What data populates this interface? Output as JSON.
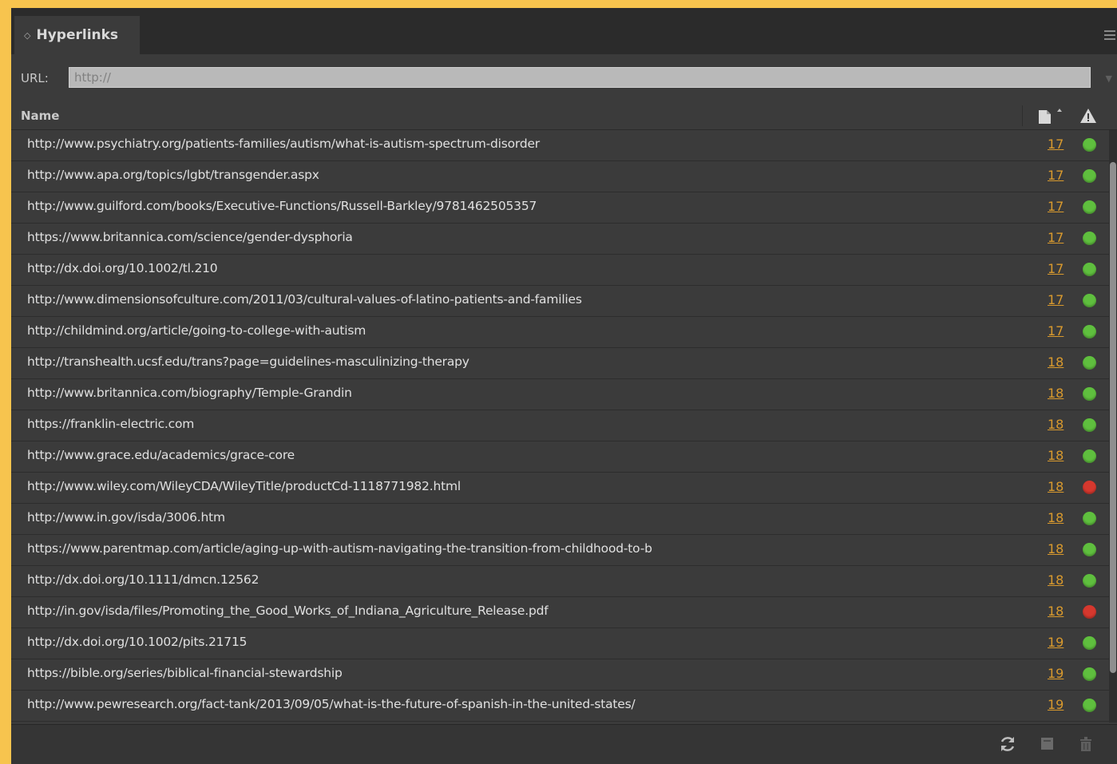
{
  "panel": {
    "title": "Hyperlinks",
    "tab_arrows": "◇"
  },
  "url_bar": {
    "label": "URL:",
    "placeholder": "http://"
  },
  "columns": {
    "name": "Name"
  },
  "colors": {
    "status_ok": "#5fbf3e",
    "status_error": "#d6382e",
    "page_link": "#d99a2e"
  },
  "hyperlinks": [
    {
      "url": "http://www.psychiatry.org/patients-families/autism/what-is-autism-spectrum-disorder",
      "page": "17",
      "status": "ok"
    },
    {
      "url": "http://www.apa.org/topics/lgbt/transgender.aspx",
      "page": "17",
      "status": "ok"
    },
    {
      "url": "http://www.guilford.com/books/Executive-Functions/Russell-Barkley/9781462505357",
      "page": "17",
      "status": "ok"
    },
    {
      "url": "https://www.britannica.com/science/gender-dysphoria",
      "page": "17",
      "status": "ok"
    },
    {
      "url": "http://dx.doi.org/10.1002/tl.210",
      "page": "17",
      "status": "ok"
    },
    {
      "url": "http://www.dimensionsofculture.com/2011/03/cultural-values-of-latino-patients-and-families",
      "page": "17",
      "status": "ok"
    },
    {
      "url": "http://childmind.org/article/going-to-college-with-autism",
      "page": "17",
      "status": "ok"
    },
    {
      "url": "http://transhealth.ucsf.edu/trans?page=guidelines-masculinizing-therapy",
      "page": "18",
      "status": "ok"
    },
    {
      "url": "http://www.britannica.com/biography/Temple-Grandin",
      "page": "18",
      "status": "ok"
    },
    {
      "url": "https://franklin-electric.com",
      "page": "18",
      "status": "ok"
    },
    {
      "url": "http://www.grace.edu/academics/grace-core",
      "page": "18",
      "status": "ok"
    },
    {
      "url": "http://www.wiley.com/WileyCDA/WileyTitle/productCd-1118771982.html",
      "page": "18",
      "status": "error"
    },
    {
      "url": "http://www.in.gov/isda/3006.htm",
      "page": "18",
      "status": "ok"
    },
    {
      "url": "https://www.parentmap.com/article/aging-up-with-autism-navigating-the-transition-from-childhood-to-b",
      "page": "18",
      "status": "ok"
    },
    {
      "url": "http://dx.doi.org/10.1111/dmcn.12562",
      "page": "18",
      "status": "ok"
    },
    {
      "url": "http://in.gov/isda/files/Promoting_the_Good_Works_of_Indiana_Agriculture_Release.pdf",
      "page": "18",
      "status": "error"
    },
    {
      "url": "http://dx.doi.org/10.1002/pits.21715",
      "page": "19",
      "status": "ok"
    },
    {
      "url": "https://bible.org/series/biblical-financial-stewardship",
      "page": "19",
      "status": "ok"
    },
    {
      "url": "http://www.pewresearch.org/fact-tank/2013/09/05/what-is-the-future-of-spanish-in-the-united-states/",
      "page": "19",
      "status": "ok"
    }
  ],
  "footer": {
    "icons": [
      "refresh-icon",
      "new-hyperlink-icon",
      "delete-icon"
    ]
  }
}
